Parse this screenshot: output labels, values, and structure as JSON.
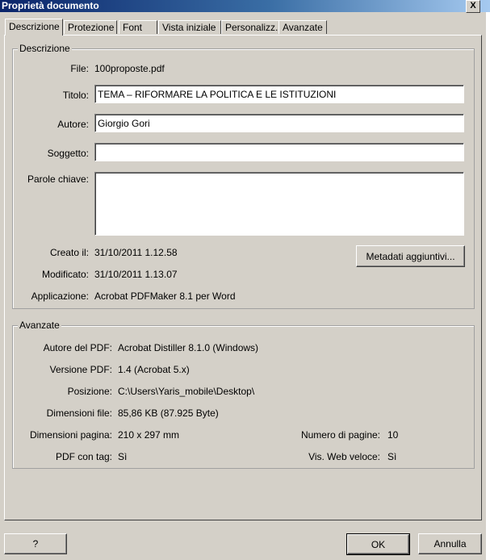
{
  "window": {
    "title": "Proprietà documento",
    "close_glyph": "X"
  },
  "tabs": [
    {
      "label": "Descrizione",
      "active": true
    },
    {
      "label": "Protezione",
      "active": false
    },
    {
      "label": "Font",
      "active": false
    },
    {
      "label": "Vista iniziale",
      "active": false
    },
    {
      "label": "Personalizz.",
      "active": false
    },
    {
      "label": "Avanzate",
      "active": false
    }
  ],
  "description": {
    "group_label": "Descrizione",
    "file_label": "File:",
    "file_value": "100proposte.pdf",
    "title_label": "Titolo:",
    "title_value": "TEMA – RIFORMARE LA POLITICA E LE ISTITUZIONI",
    "author_label": "Autore:",
    "author_value": "Giorgio Gori",
    "subject_label": "Soggetto:",
    "subject_value": "",
    "keywords_label": "Parole chiave:",
    "keywords_value": "",
    "created_label": "Creato il:",
    "created_value": "31/10/2011 1.12.58",
    "modified_label": "Modificato:",
    "modified_value": "31/10/2011 1.13.07",
    "application_label": "Applicazione:",
    "application_value": "Acrobat PDFMaker 8.1 per Word",
    "metadata_button": "Metadati aggiuntivi..."
  },
  "advanced": {
    "group_label": "Avanzate",
    "pdf_producer_label": "Autore del PDF:",
    "pdf_producer_value": "Acrobat Distiller 8.1.0 (Windows)",
    "pdf_version_label": "Versione PDF:",
    "pdf_version_value": "1.4 (Acrobat 5.x)",
    "location_label": "Posizione:",
    "location_value": "C:\\Users\\Yaris_mobile\\Desktop\\",
    "file_size_label": "Dimensioni file:",
    "file_size_value": "85,86 KB (87.925 Byte)",
    "page_size_label": "Dimensioni pagina:",
    "page_size_value": "210 x 297 mm",
    "page_count_label": "Numero di pagine:",
    "page_count_value": "10",
    "tagged_label": "PDF con tag:",
    "tagged_value": "Sì",
    "fast_web_label": "Vis. Web veloce:",
    "fast_web_value": "Sì"
  },
  "footer": {
    "help_button": "?",
    "ok_button": "OK",
    "cancel_button": "Annulla"
  }
}
